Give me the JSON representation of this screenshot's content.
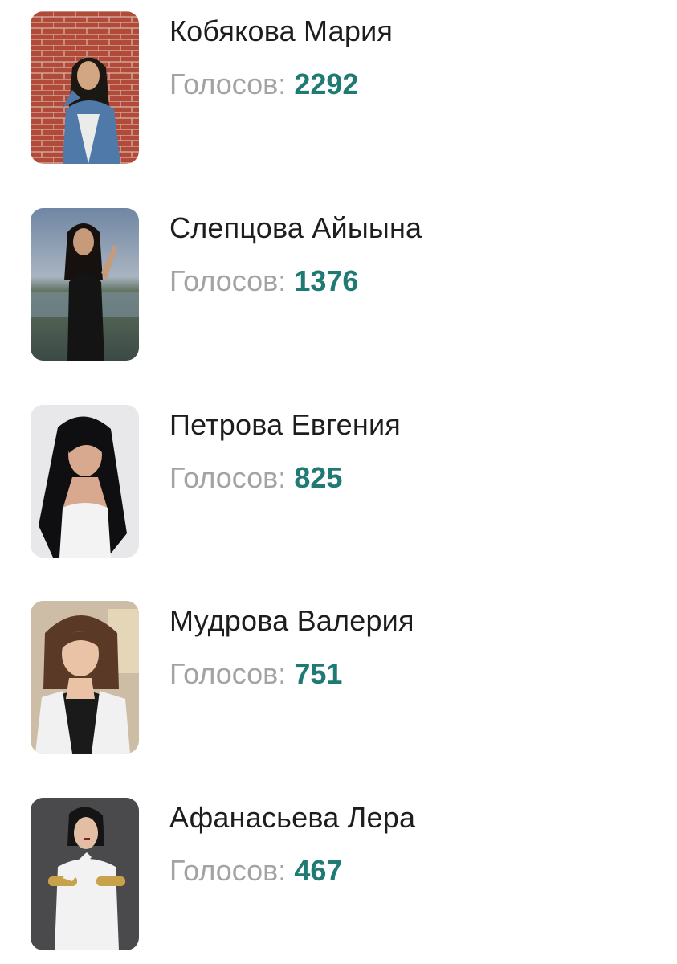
{
  "contestants": [
    {
      "name": "Кобякова Мария",
      "votes_label": "Голосов:",
      "votes": "2292",
      "photo": "portrait-brick-wall-denim-jacket"
    },
    {
      "name": "Слепцова Айыына",
      "votes_label": "Голосов:",
      "votes": "1376",
      "photo": "portrait-black-dress-lake"
    },
    {
      "name": "Петрова Евгения",
      "votes_label": "Голосов:",
      "votes": "825",
      "photo": "portrait-white-top-studio"
    },
    {
      "name": "Мудрова Валерия",
      "votes_label": "Голосов:",
      "votes": "751",
      "photo": "portrait-white-shirt-indoor"
    },
    {
      "name": "Афанасьева Лера",
      "votes_label": "Голосов:",
      "votes": "467",
      "photo": "portrait-white-turtleneck-grey-background"
    }
  ],
  "colors": {
    "name": "#1d1d1f",
    "votes_label": "#a3a3a3",
    "votes_count": "#1f7a74"
  }
}
